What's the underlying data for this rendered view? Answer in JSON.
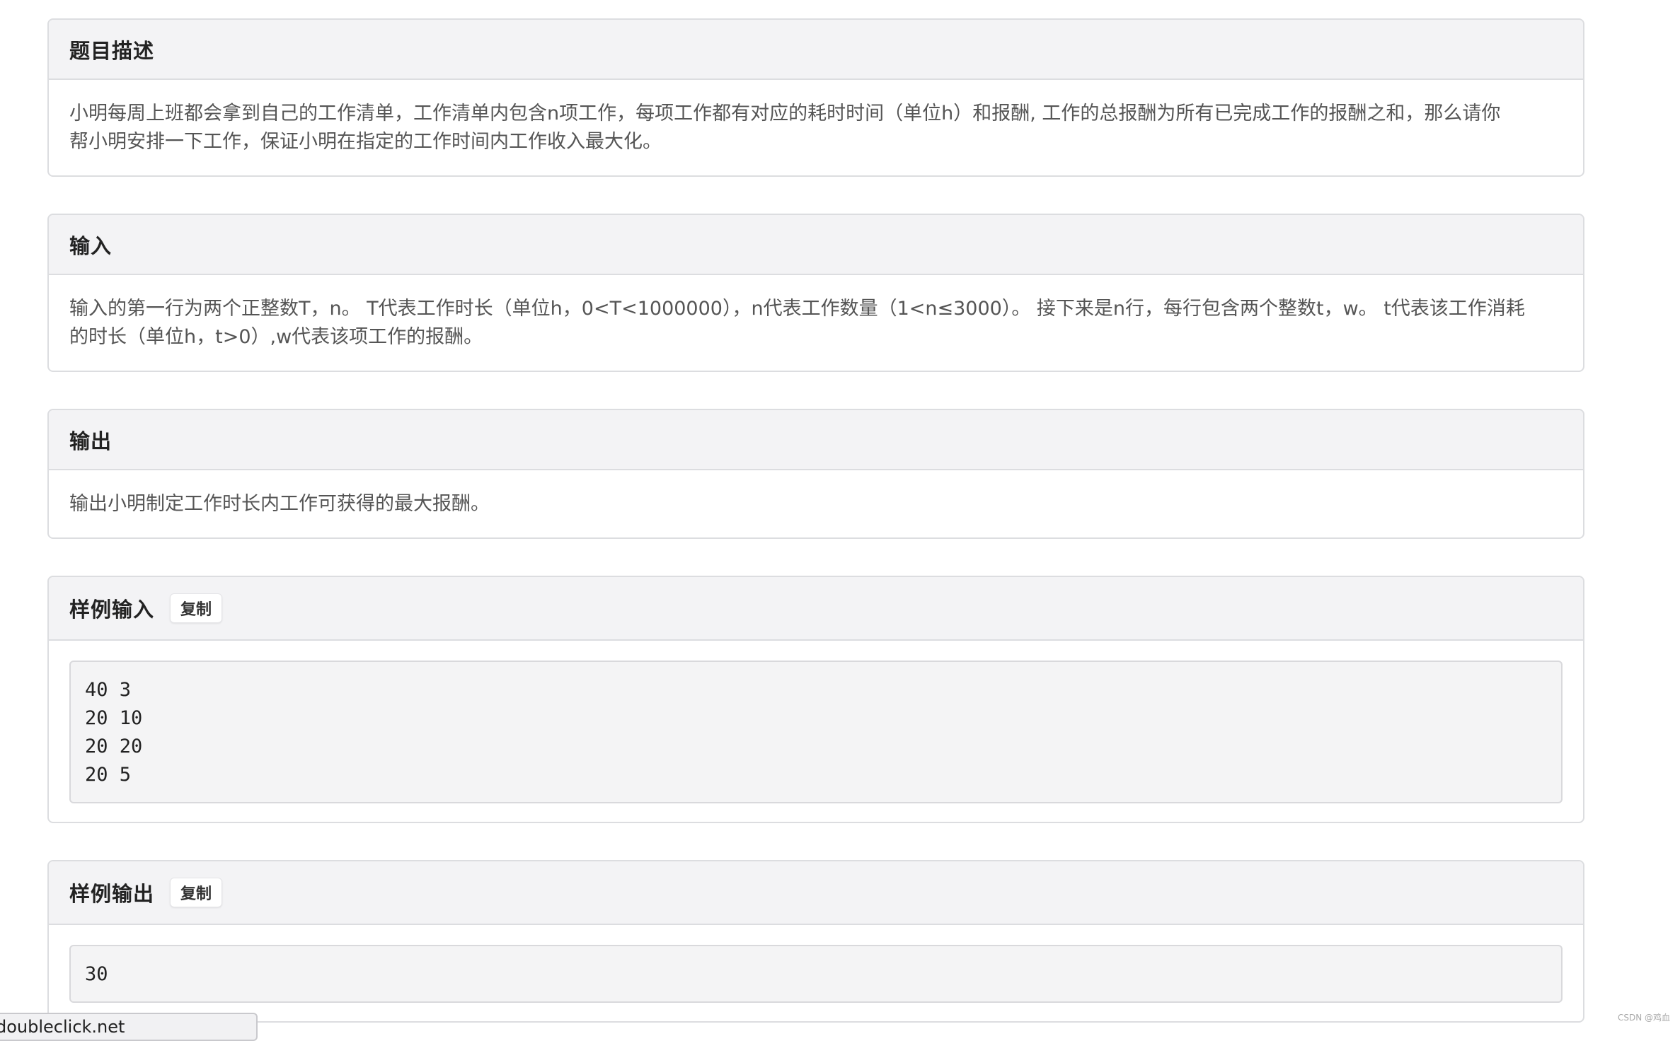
{
  "sections": {
    "description": {
      "title": "题目描述",
      "line1": "小明每周上班都会拿到自己的工作清单，工作清单内包含n项工作，每项工作都有对应的耗时时间（单位h）和报酬, 工作的总报酬为所有已完成工作的报酬之和，那么请你",
      "line2": "帮小明安排一下工作，保证小明在指定的工作时间内工作收入最大化。"
    },
    "input": {
      "title": "输入",
      "line1": "输入的第一行为两个正整数T，n。 T代表工作时长（单位h，0<T<1000000），n代表工作数量（1<n≤3000）。 接下来是n行，每行包含两个整数t，w。 t代表该工作消耗",
      "line2": "的时长（单位h，t>0）,w代表该项工作的报酬。"
    },
    "output": {
      "title": "输出",
      "text": "输出小明制定工作时长内工作可获得的最大报酬。"
    },
    "sample_input": {
      "title": "样例输入",
      "copy_label": "复制",
      "code": "40 3\n20 10\n20 20\n20 5"
    },
    "sample_output": {
      "title": "样例输出",
      "copy_label": "复制",
      "code": "30"
    }
  },
  "status_bar": {
    "text": "doubleclick.net"
  },
  "watermark": "CSDN @鸡血"
}
